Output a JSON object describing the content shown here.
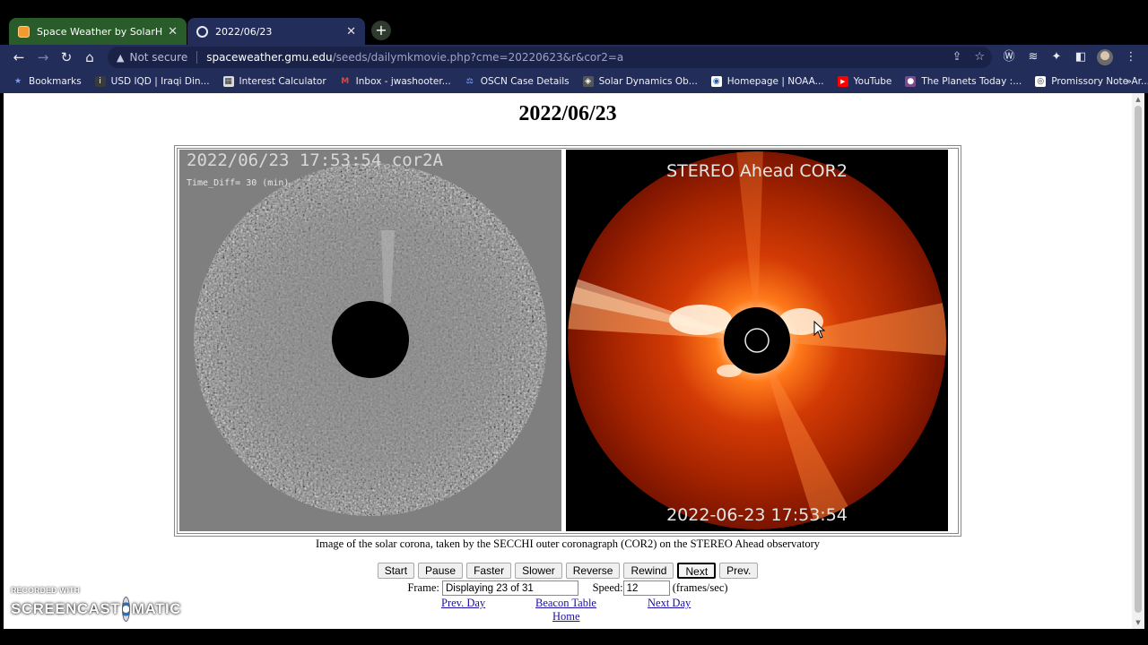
{
  "browser": {
    "tabs": [
      {
        "title": "Space Weather by SolarHam",
        "active": false
      },
      {
        "title": "2022/06/23",
        "active": true
      }
    ],
    "omnibox": {
      "warning": "Not secure",
      "host": "spaceweather.gmu.edu",
      "path": "/seeds/dailymkmovie.php?cme=20220623&r&cor2=a"
    },
    "bookmarks": [
      {
        "label": "Bookmarks",
        "icon": "star-icon"
      },
      {
        "label": "USD IQD | Iraqi Din...",
        "icon": "site-icon"
      },
      {
        "label": "Interest Calculator",
        "icon": "calculator-icon"
      },
      {
        "label": "Inbox - jwashooter...",
        "icon": "gmail-icon"
      },
      {
        "label": "OSCN Case Details",
        "icon": "site-icon"
      },
      {
        "label": "Solar Dynamics Ob...",
        "icon": "site-icon"
      },
      {
        "label": "Homepage | NOAA...",
        "icon": "site-icon"
      },
      {
        "label": "YouTube",
        "icon": "youtube-icon"
      },
      {
        "label": "The Planets Today :...",
        "icon": "site-icon"
      },
      {
        "label": "Promissory Note Ar...",
        "icon": "site-icon"
      }
    ],
    "more_bookmarks": "»"
  },
  "page": {
    "title": "2022/06/23",
    "left_image": {
      "label": "2022/06/23 17:53:54 cor2A",
      "time_diff": "Time_Diff= 30 (min)"
    },
    "right_image": {
      "label": "STEREO Ahead COR2",
      "timestamp": "2022-06-23 17:53:54"
    },
    "caption": "Image of the solar corona, taken by the SECCHI outer coronagraph (COR2) on the STEREO Ahead observatory",
    "controls": [
      "Start",
      "Pause",
      "Faster",
      "Slower",
      "Reverse",
      "Rewind",
      "Next",
      "Prev."
    ],
    "frame_label": "Frame:",
    "frame_value": "Displaying 23 of 31",
    "speed_label": "Speed:",
    "speed_value": "12",
    "speed_unit": "(frames/sec)",
    "links": {
      "prev_day": "Prev. Day",
      "beacon_table": "Beacon Table",
      "next_day": "Next Day",
      "home": "Home"
    }
  },
  "watermark": {
    "top": "RECORDED WITH",
    "left": "SCREENCAST",
    "right": "MATIC"
  }
}
